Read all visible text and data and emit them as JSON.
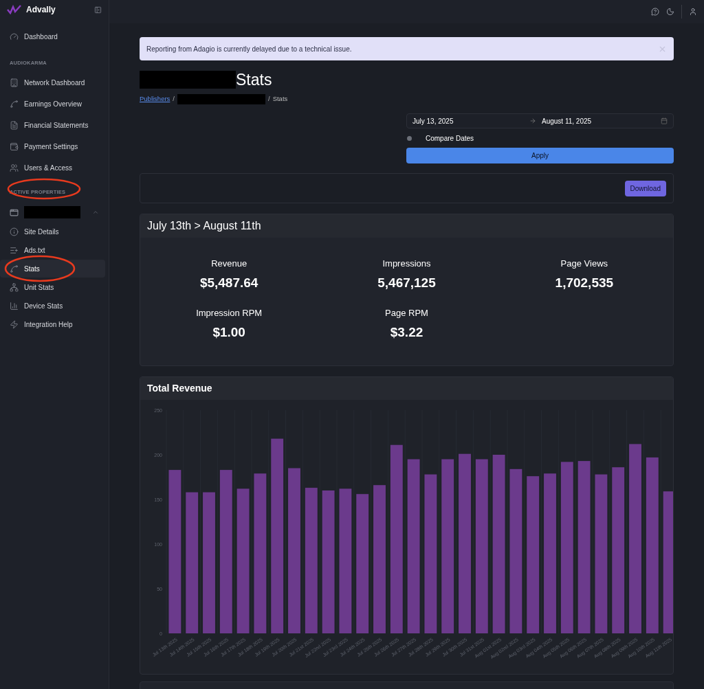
{
  "brand": {
    "name": "Advally"
  },
  "sidebar": {
    "top_items": [
      {
        "label": "Dashboard",
        "selected": false
      }
    ],
    "sections": [
      {
        "title": "AUDIOKARMA",
        "items": [
          {
            "label": "Network Dashboard",
            "selected": false
          },
          {
            "label": "Earnings Overview",
            "selected": false
          },
          {
            "label": "Financial Statements",
            "selected": false
          },
          {
            "label": "Payment Settings",
            "selected": false
          },
          {
            "label": "Users & Access",
            "selected": false
          }
        ]
      },
      {
        "title": "ACTIVE PROPERTIES",
        "property": {
          "expanded": true
        },
        "items": [
          {
            "label": "Site Details",
            "selected": false
          },
          {
            "label": "Ads.txt",
            "selected": false
          },
          {
            "label": "Stats",
            "selected": true
          },
          {
            "label": "Unit Stats",
            "selected": false
          },
          {
            "label": "Device Stats",
            "selected": false
          },
          {
            "label": "Integration Help",
            "selected": false
          }
        ]
      }
    ]
  },
  "alert": {
    "message": "Reporting from Adagio is currently delayed due to a technical issue."
  },
  "page": {
    "title": "Stats",
    "breadcrumb": [
      {
        "label": "Publishers",
        "kind": "link"
      },
      {
        "label": "/",
        "kind": "separator"
      },
      {
        "kind": "redacted"
      },
      {
        "label": "/",
        "kind": "separator"
      },
      {
        "label": "Stats",
        "kind": "text"
      }
    ]
  },
  "date_range": {
    "start": "July 13, 2025",
    "end": "August 11, 2025",
    "compare_label": "Compare Dates",
    "compare_on": false,
    "apply": "Apply"
  },
  "download": "Download",
  "summary": {
    "title": "July 13th > August 11th",
    "metrics": [
      {
        "label": "Revenue",
        "value": "$5,487.64"
      },
      {
        "label": "Impressions",
        "value": "5,467,125"
      },
      {
        "label": "Page Views",
        "value": "1,702,535"
      },
      {
        "label": "Impression RPM",
        "value": "$1.00"
      },
      {
        "label": "Page RPM",
        "value": "$3.22"
      }
    ]
  },
  "revenue_card": {
    "title": "Total Revenue",
    "chart_data": {
      "type": "bar",
      "categories": [
        "Jul 13th 2025",
        "Jul 14th 2025",
        "Jul 15th 2025",
        "Jul 16th 2025",
        "Jul 17th 2025",
        "Jul 18th 2025",
        "Jul 19th 2025",
        "Jul 20th 2025",
        "Jul 21st 2025",
        "Jul 22nd 2025",
        "Jul 23rd 2025",
        "Jul 24th 2025",
        "Jul 25th 2025",
        "Jul 26th 2025",
        "Jul 27th 2025",
        "Jul 28th 2025",
        "Jul 29th 2025",
        "Jul 30th 2025",
        "Jul 31st 2025",
        "Aug 01st 2025",
        "Aug 02nd 2025",
        "Aug 03rd 2025",
        "Aug 04th 2025",
        "Aug 05th 2025",
        "Aug 06th 2025",
        "Aug 07th 2025",
        "Aug 08th 2025",
        "Aug 09th 2025",
        "Aug 10th 2025",
        "Aug 11th 2025"
      ],
      "series": [
        {
          "color": "#6b3a8c",
          "values": [
            183,
            158,
            158,
            183,
            162,
            179,
            218,
            185,
            163,
            160,
            162,
            156,
            166,
            211,
            195,
            178,
            195,
            201,
            195,
            200,
            184,
            176,
            179,
            192,
            193,
            178,
            186,
            212,
            197,
            159
          ]
        }
      ],
      "ylim": [
        0,
        250
      ],
      "yticks": [
        0,
        50,
        100,
        150,
        200,
        250
      ]
    }
  }
}
